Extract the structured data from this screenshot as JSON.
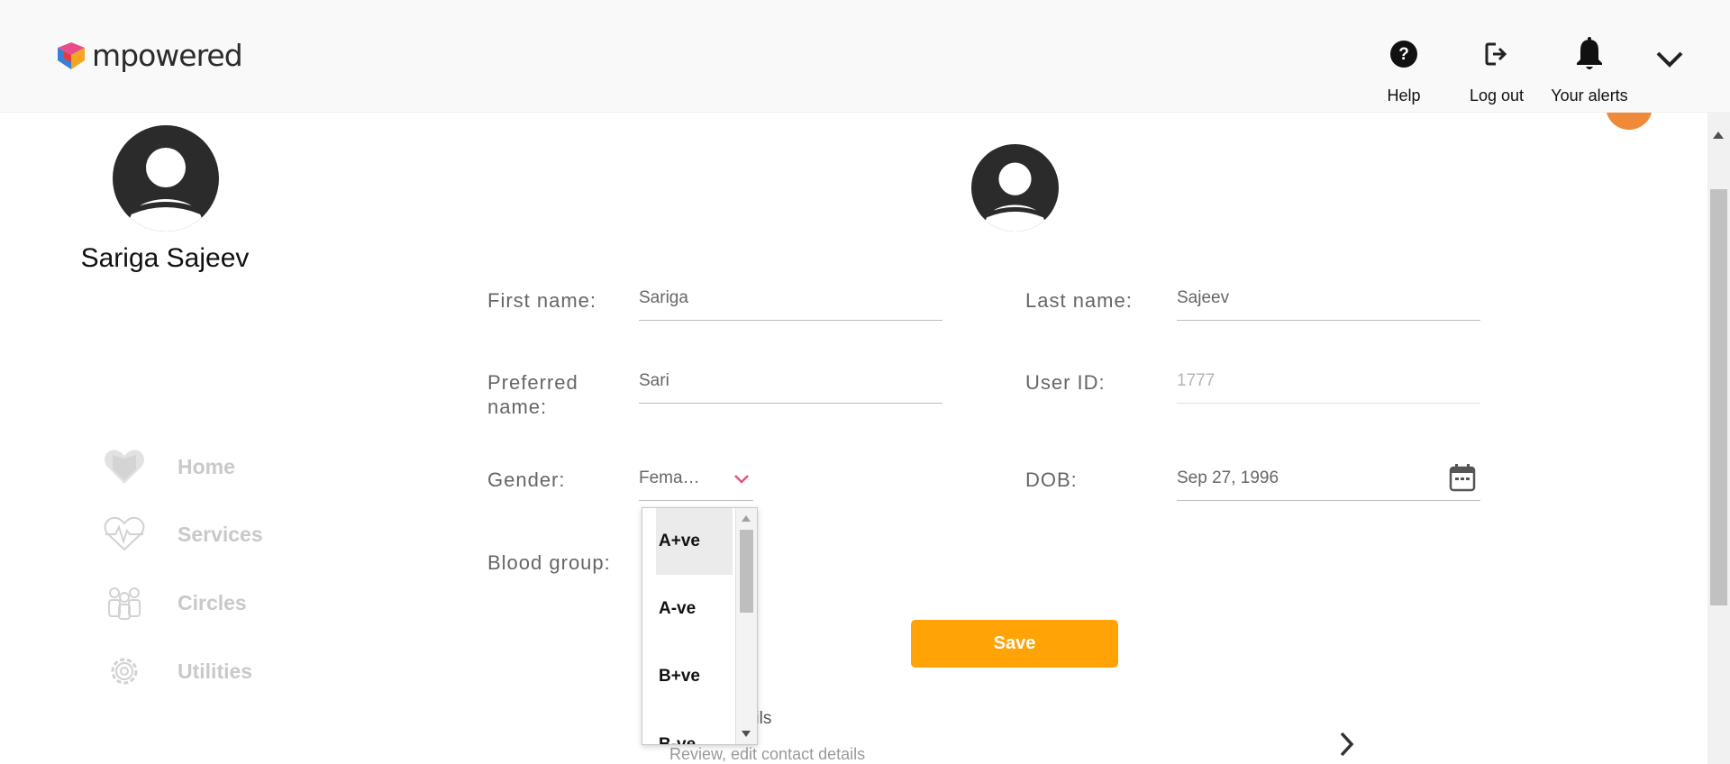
{
  "app": {
    "brand": "mpowered"
  },
  "header": {
    "help_label": "Help",
    "logout_label": "Log out",
    "alerts_label": "Your alerts"
  },
  "profile": {
    "name": "Sariga Sajeev"
  },
  "nav": {
    "items": [
      {
        "label": "Home",
        "icon": "heart-logo-icon"
      },
      {
        "label": "Services",
        "icon": "heartbeat-icon"
      },
      {
        "label": "Circles",
        "icon": "people-icon"
      },
      {
        "label": "Utilities",
        "icon": "gear-icon"
      }
    ]
  },
  "form": {
    "first_name_label": "First name:",
    "first_name_value": "Sariga",
    "last_name_label": "Last name:",
    "last_name_value": "Sajeev",
    "preferred_name_label": "Preferred name:",
    "preferred_name_value": "Sari",
    "user_id_label": "User ID:",
    "user_id_value": "1777",
    "gender_label": "Gender:",
    "gender_value": "Fema…",
    "dob_label": "DOB:",
    "dob_value": "Sep 27, 1996",
    "blood_group_label": "Blood group:",
    "blood_group_options": [
      "A+ve",
      "A-ve",
      "B+ve",
      "B-ve"
    ],
    "save_label": "Save"
  },
  "contact": {
    "title": "Contact details",
    "visible_title_fragment": "etails",
    "subtitle": "Review, edit contact details"
  },
  "colors": {
    "accent": "#ffa307",
    "dropdown_chevron": "#e0577a",
    "nav_disabled": "#c9c9c9"
  }
}
